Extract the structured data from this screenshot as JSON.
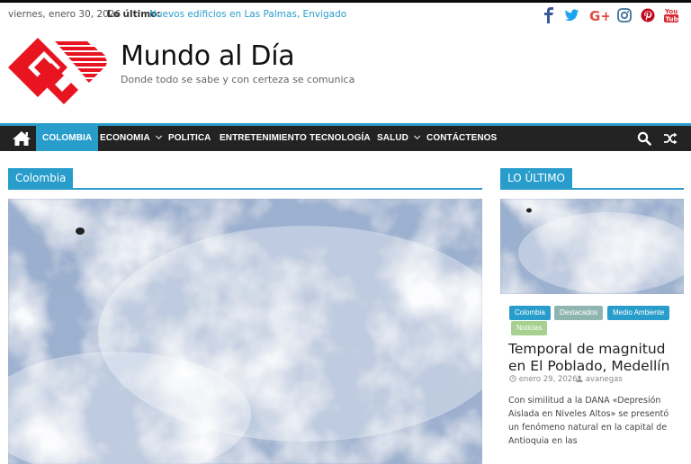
{
  "topbar": {
    "date": "viernes, enero 30, 2026",
    "latest_label": "Lo último:",
    "latest_link": "Nuevos edificios en Las Palmas, Envigado",
    "social_icons": [
      "facebook-icon",
      "twitter-icon",
      "google-plus-icon",
      "instagram-icon",
      "pinterest-icon",
      "youtube-icon"
    ],
    "social_colors": {
      "facebook": "#3b5998",
      "twitter": "#1da1f2",
      "google_plus": "#dc4e41",
      "instagram": "#3f729b",
      "pinterest": "#bd081c",
      "youtube": "#d9272e"
    }
  },
  "header": {
    "title": "Mundo al Día",
    "tagline": "Donde todo se sabe y con certeza se comunica",
    "logo_color": "#e8141f"
  },
  "nav": {
    "items": [
      {
        "label": "COLOMBIA",
        "active": true
      },
      {
        "label": "ECONOMIA",
        "dropdown": true
      },
      {
        "label": "POLITICA"
      },
      {
        "label": "ENTRETENIMIENTO"
      },
      {
        "label": "TECNOLOGÍA"
      },
      {
        "label": "SALUD",
        "dropdown": true
      },
      {
        "label": "CONTÁCTENOS"
      }
    ],
    "icons": [
      "home-icon",
      "search-icon",
      "shuffle-icon"
    ]
  },
  "main": {
    "section_title": "Colombia"
  },
  "sidebar": {
    "section_title": "LO ÚLTIMO",
    "categories": [
      {
        "label": "Colombia",
        "color": "#289dcc"
      },
      {
        "label": "Destacados",
        "color": "#8fb5b0"
      },
      {
        "label": "Medio Ambiente",
        "color": "#289dcc"
      },
      {
        "label": "Noticias",
        "color": "#a6d08f"
      }
    ],
    "post_title": "Temporal de magnitud en El Poblado, Medellín",
    "post_date": "enero 29, 2026",
    "post_author": "avanegas",
    "excerpt": "Con similitud a la DANA «Depresión Aislada en Niveles Altos»  se presentó un fenómeno natural en la capital de Antioquia en las"
  },
  "colors": {
    "accent": "#289dcc",
    "nav_bg": "#232323"
  }
}
